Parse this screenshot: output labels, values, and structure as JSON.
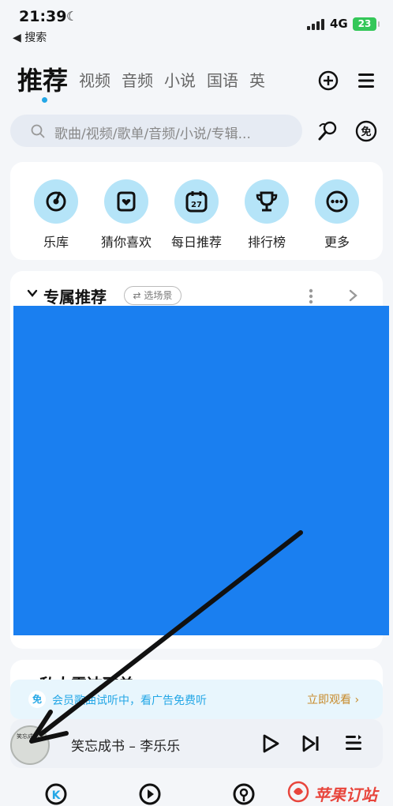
{
  "status_bar": {
    "time": "21:39",
    "back_label": "◀ 搜索",
    "network": "4G",
    "battery": "23"
  },
  "tabs": [
    {
      "label": "推荐",
      "active": true
    },
    {
      "label": "视频"
    },
    {
      "label": "音频"
    },
    {
      "label": "小说"
    },
    {
      "label": "国语"
    },
    {
      "label": "英"
    }
  ],
  "search": {
    "placeholder": "歌曲/视频/歌单/音频/小说/专辑..."
  },
  "quick_entries": [
    {
      "label": "乐库",
      "icon": "music-library-icon"
    },
    {
      "label": "猜你喜欢",
      "icon": "heart-folder-icon"
    },
    {
      "label": "每日推荐",
      "icon": "calendar-icon",
      "day": "27"
    },
    {
      "label": "排行榜",
      "icon": "trophy-icon"
    },
    {
      "label": "更多",
      "icon": "more-icon"
    }
  ],
  "recommend": {
    "title": "专属推荐",
    "scene_label": "选场景"
  },
  "next_section": {
    "title": "私人雷达歌单"
  },
  "ad_banner": {
    "badge": "免",
    "text": "会员歌曲试听中，看广告免费听",
    "cta": "立即观看 ›"
  },
  "player": {
    "song": "笑忘成书 – 李乐乐",
    "cover_text": "笑忘成书"
  },
  "watermark": {
    "text": "苹果订站"
  },
  "colors": {
    "accent": "#24a7e6",
    "banner_blue": "#1a7ff0",
    "cta_gold": "#c78a2a"
  }
}
